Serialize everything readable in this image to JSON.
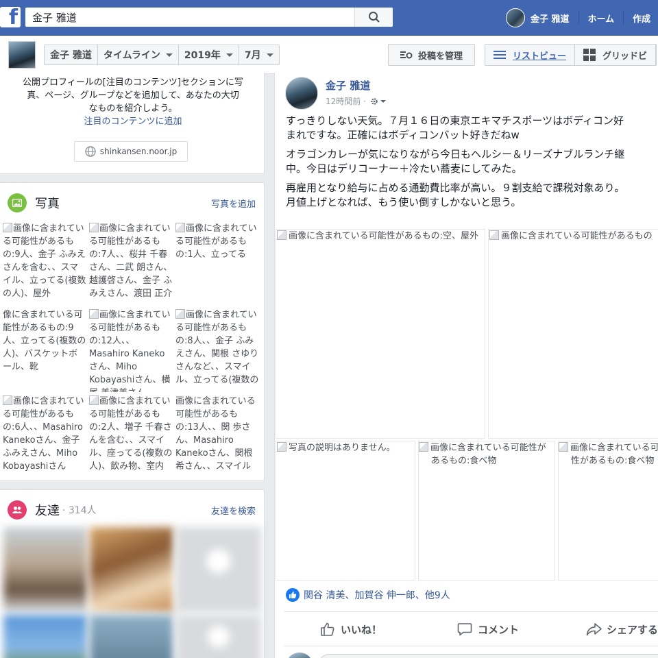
{
  "topbar": {
    "logo": "f",
    "search_value": "金子 雅道",
    "user_name": "金子 雅道",
    "home": "ホーム",
    "create": "作成"
  },
  "subnav": {
    "name": "金子 雅道",
    "timeline": "タイムライン",
    "year": "2019年",
    "month": "7月",
    "manage_posts": "投稿を管理",
    "list_view": "リストビュー",
    "grid_view": "グリッドビ"
  },
  "featured": {
    "line1": "公開プロフィールの[注目のコンテンツ]セクションに写",
    "line2": "真、ページ、グループなどを追加して、あなたの大切",
    "line3": "なものを紹介しよう。",
    "link": "注目のコンテンツに追加",
    "site": "shinkansen.noor.jp"
  },
  "photos": {
    "title": "写真",
    "action": "写真を追加",
    "items": [
      "画像に含まれている可能性があるもの:9人、金子 ふみえさんを含む、、スマイル、立ってる(複数の人)、屋外",
      "画像に含まれている可能性があるもの:7人、、桜井 千春さん、二武 朗さん、越護啓さん、金子 ふみえさん、渡田 正介",
      "画像に含まれている可能性があるもの:1人、立ってる",
      "像に含まれている可能性があるもの:9人、立ってる(複数の人)、バスケットボール、靴",
      "画像に含まれている可能性があるもの:12人、、Masahiro Kanekoさん、Miho Kobayashiさん、横尾 美津美さん",
      "画像に含まれている可能性があるもの:8人、、金子 ふみえさん、関根 さゆりさんなど、、スマイル、立ってる(複数の",
      "画像に含まれている可能性があるもの:6人、、Masahiro Kanekoさん、金子 ふみえさん、Miho Kobayashiさん",
      "画像に含まれている可能性があるもの:2人、増子 千春さんを含む、、スマイル、座ってる(複数の人)、飲み物、室内",
      "画像に含まれている可能性があるもの:13人、、関 歩さん、Masahiro Kanekoさん、関根 希さん、、スマイル"
    ]
  },
  "friends": {
    "title": "友達",
    "count": "· 314人",
    "action": "友達を検索"
  },
  "post": {
    "author": "金子 雅道",
    "time": "12時間前 ·",
    "p1a": "すっきりしない天気。７月１６日の東京エキマチスポーツはボディコン好",
    "p1b": "まれですな。正確にはボディコンバット好きだねw",
    "p2a": "オラゴンカレーが気になりながら今日もヘルシー＆リーズナブルランチ継",
    "p2b": "中。今日はデリコーナー＋冷たい蕎麦にしてみた。",
    "p3a": "再雇用となり給与に占める通勤費比率が高い。９割支給で課税対象あり。",
    "p3b": "月値上げとなれば、もう使い倒すしかないと思う。",
    "img1": "画像に含まれている可能性があるもの:空、屋外",
    "img2": "画像に含まれている可能性があるもの",
    "img3": "写真の説明はありません。",
    "img4": "画像に含まれている可能性があるもの:食べ物",
    "img5": "画像に含まれている可能性があるもの:食べ物",
    "reactions": "関谷 清美、加賀谷 伸一郎、他9人",
    "like": "いいね！",
    "comment": "コメント",
    "share": "シェアする"
  },
  "colors": {
    "brand": "#4267b2",
    "link": "#365899",
    "photos_icon": "#7ac143",
    "friends_icon": "#e4406f"
  }
}
